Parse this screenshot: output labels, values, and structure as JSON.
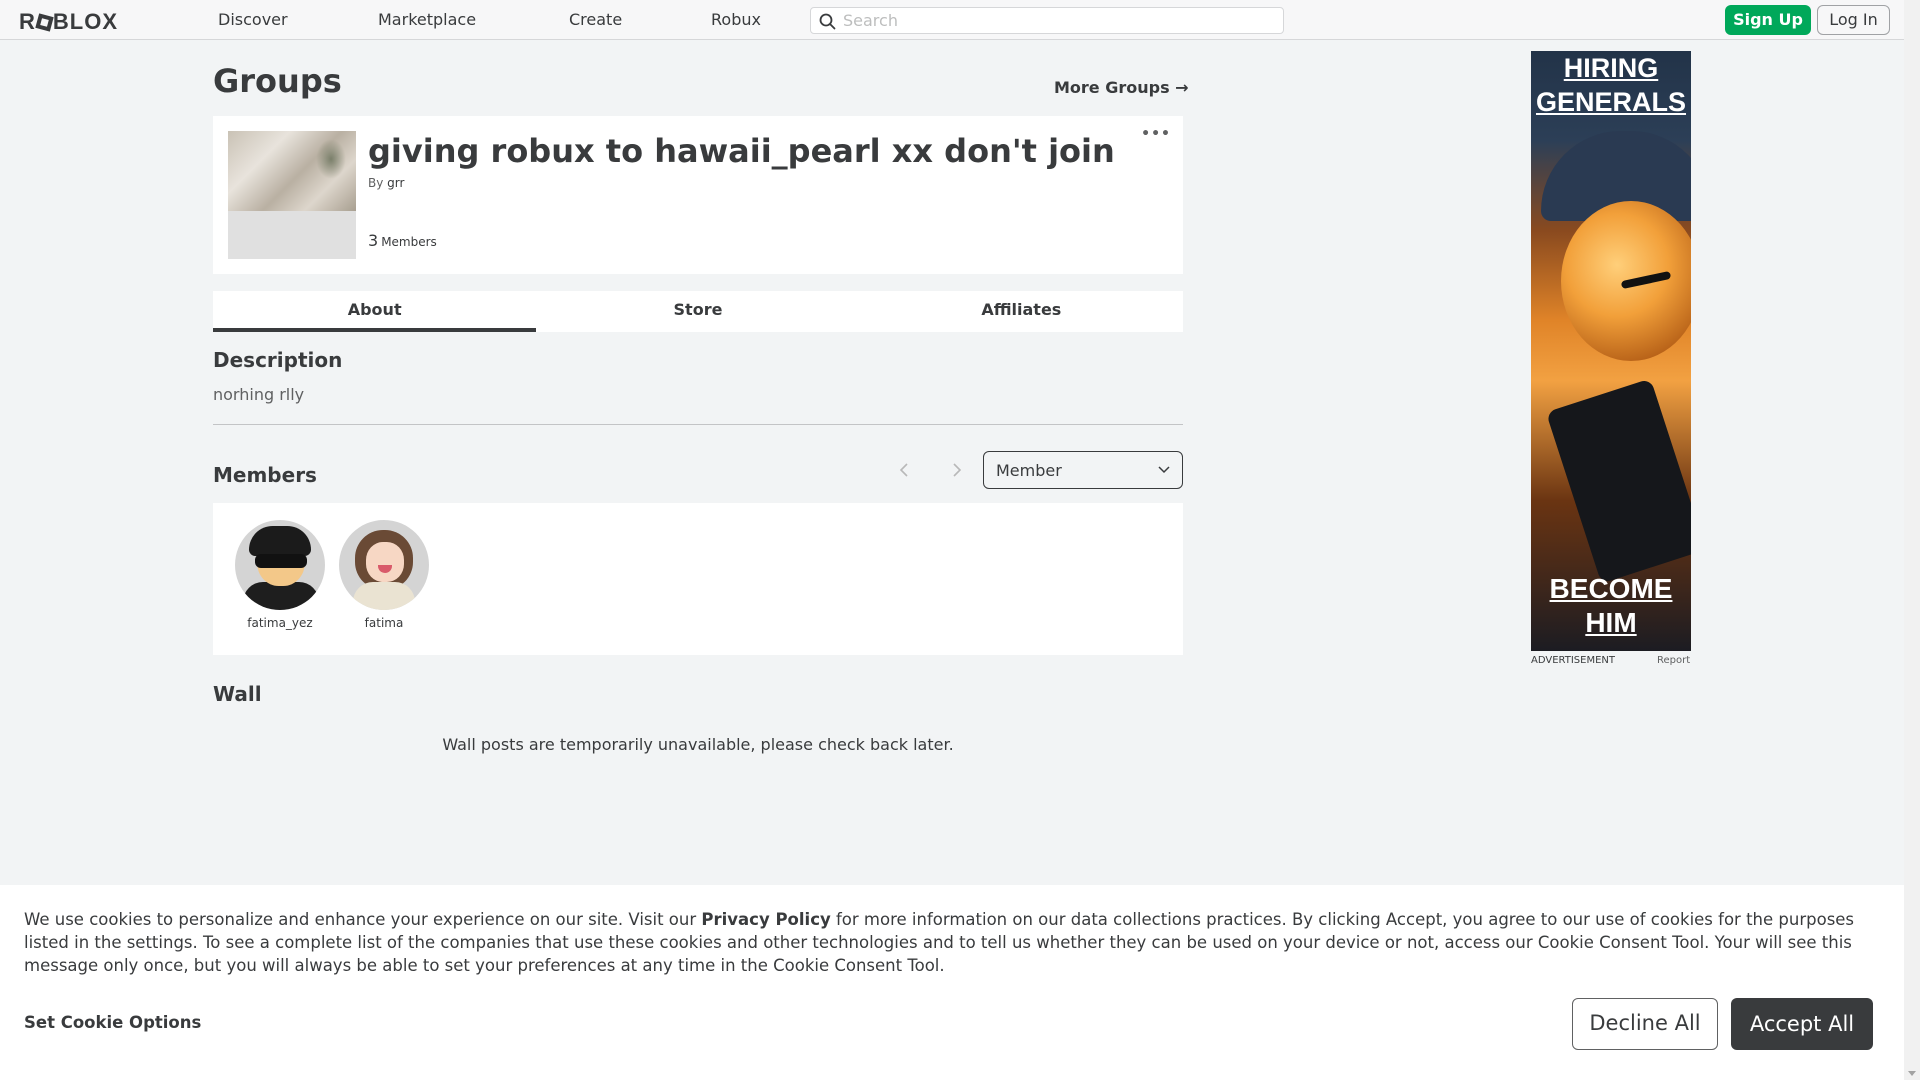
{
  "nav": {
    "logo_left": "R",
    "logo_right": "BLOX",
    "links": [
      "Discover",
      "Marketplace",
      "Create",
      "Robux"
    ],
    "search_placeholder": "Search",
    "signup_label": "Sign Up",
    "login_label": "Log In"
  },
  "page": {
    "title": "Groups",
    "more_groups": "More Groups →"
  },
  "group": {
    "name": "giving robux to hawaii_pearl xx don't join",
    "by_prefix": "By",
    "owner": "grr",
    "member_count": "3",
    "member_label": "Members",
    "more_menu": "•••"
  },
  "tabs": [
    {
      "label": "About",
      "active": true
    },
    {
      "label": "Store",
      "active": false
    },
    {
      "label": "Affiliates",
      "active": false
    }
  ],
  "description": {
    "heading": "Description",
    "text": "norhing rlly"
  },
  "members": {
    "heading": "Members",
    "role_selected": "Member",
    "list": [
      {
        "name": "fatima_yez"
      },
      {
        "name": "fatima"
      }
    ]
  },
  "wall": {
    "heading": "Wall",
    "message": "Wall posts are temporarily unavailable, please check back later."
  },
  "ad": {
    "top_text": "HIRING GENERALS",
    "bottom_text": "BECOME HIM",
    "label": "ADVERTISEMENT",
    "report": "Report"
  },
  "cookie": {
    "text_before": "We use cookies to personalize and enhance your experience on our site. Visit our ",
    "privacy_link": "Privacy Policy",
    "text_after": " for more information on our data collections practices. By clicking Accept, you agree to our use of cookies for the purposes listed in the settings. To see a complete list of the companies that use these cookies and other technologies and to tell us whether they can be used on your device or not, access our Cookie Consent Tool. Your will see this message only once, but you will always be able to set your preferences at any time in the Cookie Consent Tool.",
    "options": "Set Cookie Options",
    "decline": "Decline All",
    "accept": "Accept All"
  },
  "colors": {
    "signup_green": "#00a85a",
    "text_dark": "#393b3d",
    "page_bg": "#f2f4f5"
  }
}
